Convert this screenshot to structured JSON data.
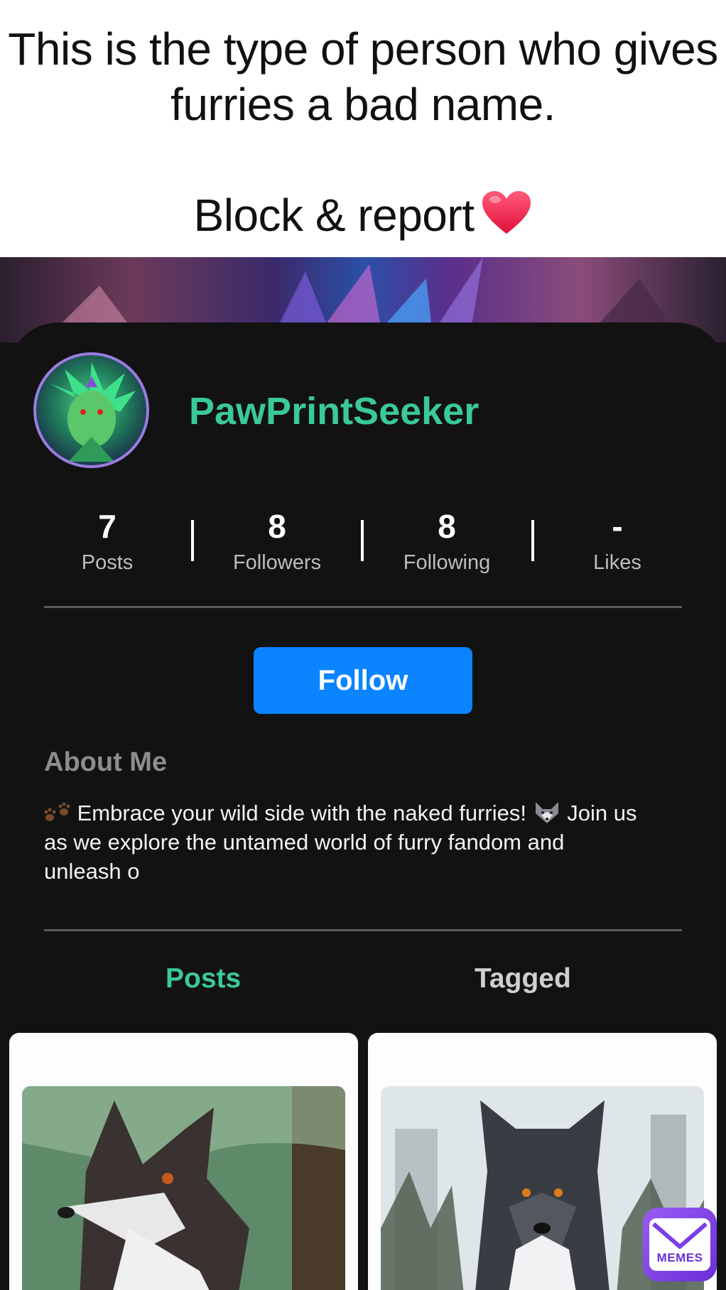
{
  "caption": {
    "line1": "This is the type of person who gives",
    "line2": "furries a bad name.",
    "line3": "Block & report"
  },
  "profile": {
    "username": "PawPrintSeeker",
    "stats": [
      {
        "value": "7",
        "label": "Posts"
      },
      {
        "value": "8",
        "label": "Followers"
      },
      {
        "value": "8",
        "label": "Following"
      },
      {
        "value": "-",
        "label": "Likes"
      }
    ],
    "follow_label": "Follow",
    "about_title": "About Me",
    "about_line1": "Embrace your wild side with the naked furries!",
    "about_line1b": "Join us",
    "about_line2": "as we explore the untamed world of furry fandom and",
    "about_line3": "unleash o"
  },
  "tabs": [
    {
      "label": "Posts",
      "active": true
    },
    {
      "label": "Tagged",
      "active": false
    }
  ],
  "watermark": {
    "label": "MEMES"
  },
  "colors": {
    "accent": "#3ac99a",
    "follow_button": "#0a84ff",
    "background": "#121212",
    "badge": "#7a3fe6"
  },
  "icons": [
    "heart-icon",
    "paw-prints-icon",
    "wolf-face-icon",
    "memes-envelope-icon"
  ]
}
